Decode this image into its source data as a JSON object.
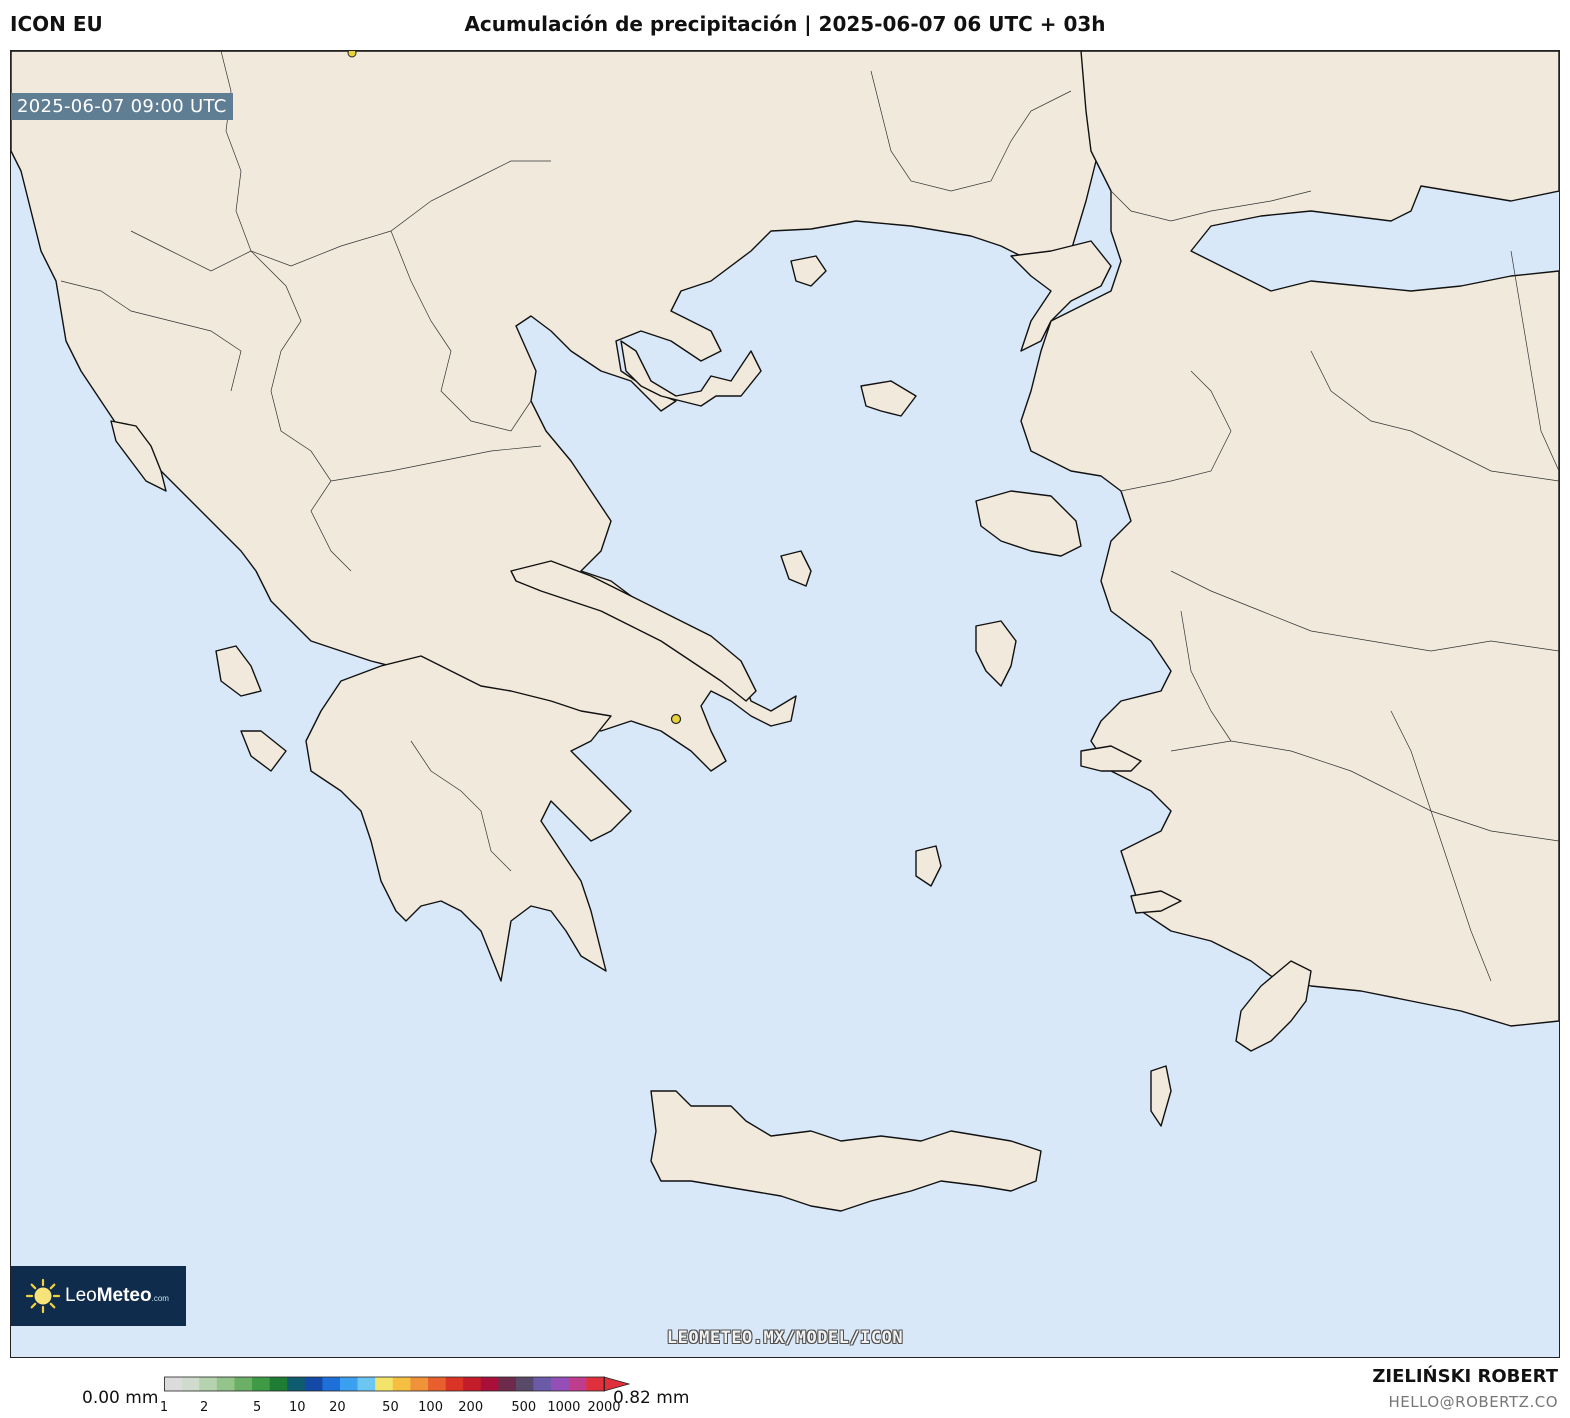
{
  "header": {
    "model": "ICON EU",
    "title": "Acumulación de precipitación | 2025-06-07 06 UTC + 03h"
  },
  "map": {
    "valid_time": "2025-06-07 09:00 UTC",
    "watermark": "LEOMETEO.MX/MODEL/ICON",
    "sea_color": "#d8e8f8",
    "land_color": "#f0e9dc",
    "marker_color": "#e6d23a"
  },
  "logo": {
    "brand_light": "Leo",
    "brand_bold": "Meteo",
    "suffix": ".com"
  },
  "legend": {
    "min_label": "0.00 mm",
    "max_label": "0.82 mm",
    "ticks": [
      "1",
      "2",
      "5",
      "10",
      "20",
      "50",
      "100",
      "200",
      "500",
      "1000",
      "2000"
    ],
    "colors": [
      "#dcdcdc",
      "#cfdccd",
      "#b6d3b0",
      "#93c48a",
      "#6bb066",
      "#3f9a45",
      "#1e7c35",
      "#0f5c6e",
      "#124aa6",
      "#1f6fd8",
      "#3ba0ef",
      "#6cc6f2",
      "#f2e46b",
      "#f5c042",
      "#f0923a",
      "#e8602e",
      "#dc3327",
      "#c41c2a",
      "#a8103a",
      "#6e2a4a",
      "#5a4a6a",
      "#6a5aa8",
      "#9450b8",
      "#c03c8c",
      "#e0303c"
    ]
  },
  "footer": {
    "author": "ZIELIŃSKI ROBERT",
    "email": "HELLO@ROBERTZ.CO"
  }
}
